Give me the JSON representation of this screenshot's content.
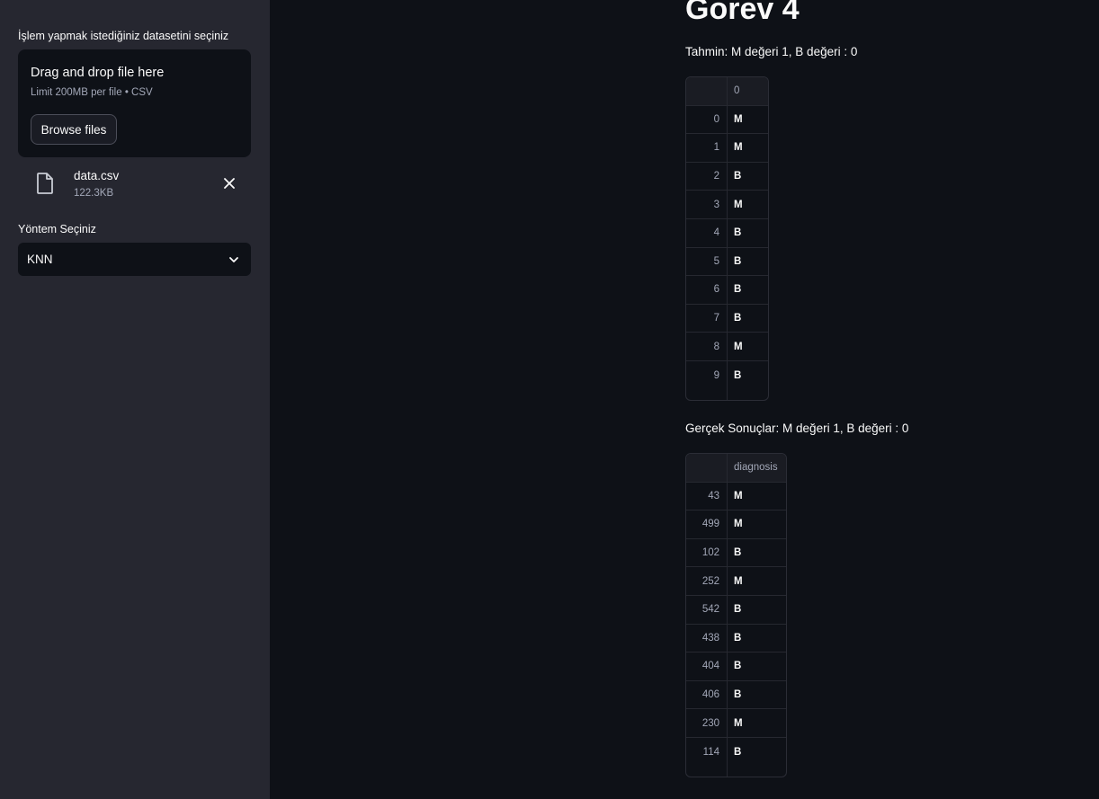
{
  "sidebar": {
    "upload_label": "İşlem yapmak istediğiniz datasetini seçiniz",
    "dropzone_title": "Drag and drop file here",
    "dropzone_limit": "Limit 200MB per file • CSV",
    "browse_button": "Browse files",
    "file_name": "data.csv",
    "file_size": "122.3KB",
    "method_label": "Yöntem Seçiniz",
    "method_value": "KNN"
  },
  "main": {
    "title": "Gorev 4",
    "prediction_caption": "Tahmin: M değeri 1, B değeri : 0",
    "prediction_table": {
      "header": "0",
      "rows": [
        {
          "idx": "0",
          "val": "M"
        },
        {
          "idx": "1",
          "val": "M"
        },
        {
          "idx": "2",
          "val": "B"
        },
        {
          "idx": "3",
          "val": "M"
        },
        {
          "idx": "4",
          "val": "B"
        },
        {
          "idx": "5",
          "val": "B"
        },
        {
          "idx": "6",
          "val": "B"
        },
        {
          "idx": "7",
          "val": "B"
        },
        {
          "idx": "8",
          "val": "M"
        },
        {
          "idx": "9",
          "val": "B"
        }
      ]
    },
    "actual_caption": "Gerçek Sonuçlar: M değeri 1, B değeri : 0",
    "actual_table": {
      "header": "diagnosis",
      "rows": [
        {
          "idx": "43",
          "val": "M"
        },
        {
          "idx": "499",
          "val": "M"
        },
        {
          "idx": "102",
          "val": "B"
        },
        {
          "idx": "252",
          "val": "M"
        },
        {
          "idx": "542",
          "val": "B"
        },
        {
          "idx": "438",
          "val": "B"
        },
        {
          "idx": "404",
          "val": "B"
        },
        {
          "idx": "406",
          "val": "B"
        },
        {
          "idx": "230",
          "val": "M"
        },
        {
          "idx": "114",
          "val": "B"
        }
      ]
    }
  },
  "icons": {
    "file": "file-icon",
    "close": "close-icon",
    "chevron": "chevron-down-icon"
  }
}
